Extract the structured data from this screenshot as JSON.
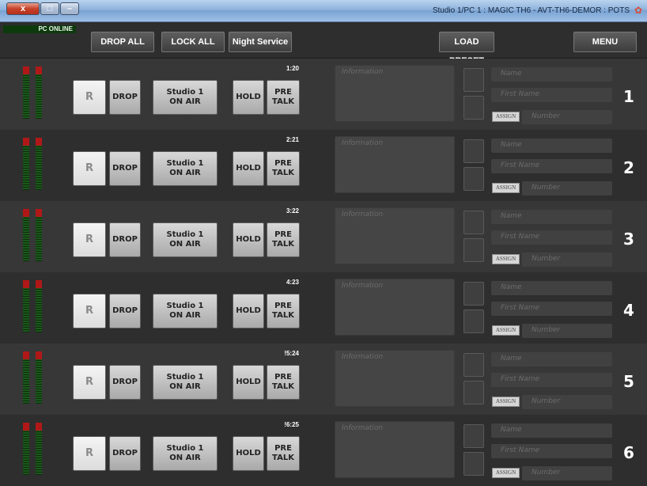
{
  "window": {
    "title": "Studio 1/PC 1 : MAGIC TH6 - AVT-TH6-DEMOR : POTS",
    "close_label": "x",
    "maximize_label": "□",
    "minimize_label": "–"
  },
  "status": {
    "pc_online": "PC ONLINE"
  },
  "toolbar": {
    "drop_all": "DROP ALL",
    "lock_all": "LOCK ALL",
    "night_service": "Night Service",
    "load_preset": "LOAD PRESET",
    "menu": "MENU"
  },
  "lines": [
    {
      "number": "1",
      "timer": "1:20",
      "r_label": "R",
      "drop_label": "DROP",
      "studio_label": "Studio 1",
      "studio_sub": "ON AIR",
      "hold_label": "HOLD",
      "pre_label": "PRE",
      "talk_label": "TALK",
      "info_placeholder": "Information",
      "name_placeholder": "Name",
      "first_name_placeholder": "First Name",
      "assign_label": "ASSIGN",
      "number_placeholder": "Number"
    },
    {
      "number": "2",
      "timer": "2:21",
      "r_label": "R",
      "drop_label": "DROP",
      "studio_label": "Studio 1",
      "studio_sub": "ON AIR",
      "hold_label": "HOLD",
      "pre_label": "PRE",
      "talk_label": "TALK",
      "info_placeholder": "Information",
      "name_placeholder": "Name",
      "first_name_placeholder": "First Name",
      "assign_label": "ASSIGN",
      "number_placeholder": "Number"
    },
    {
      "number": "3",
      "timer": "3:22",
      "r_label": "R",
      "drop_label": "DROP",
      "studio_label": "Studio 1",
      "studio_sub": "ON AIR",
      "hold_label": "HOLD",
      "pre_label": "PRE",
      "talk_label": "TALK",
      "info_placeholder": "Information",
      "name_placeholder": "Name",
      "first_name_placeholder": "First Name",
      "assign_label": "ASSIGN",
      "number_placeholder": "Number"
    },
    {
      "number": "4",
      "timer": "4:23",
      "r_label": "R",
      "drop_label": "DROP",
      "studio_label": "Studio 1",
      "studio_sub": "ON AIR",
      "hold_label": "HOLD",
      "pre_label": "PRE",
      "talk_label": "TALK",
      "info_placeholder": "Information",
      "name_placeholder": "Name",
      "first_name_placeholder": "First Name",
      "assign_label": "ASSIGN",
      "number_placeholder": "Number"
    },
    {
      "number": "5",
      "timer": "!5:24",
      "r_label": "R",
      "drop_label": "DROP",
      "studio_label": "Studio 1",
      "studio_sub": "ON AIR",
      "hold_label": "HOLD",
      "pre_label": "PRE",
      "talk_label": "TALK",
      "info_placeholder": "Information",
      "name_placeholder": "Name",
      "first_name_placeholder": "First Name",
      "assign_label": "ASSIGN",
      "number_placeholder": "Number"
    },
    {
      "number": "6",
      "timer": "!6:25",
      "r_label": "R",
      "drop_label": "DROP",
      "studio_label": "Studio 1",
      "studio_sub": "ON AIR",
      "hold_label": "HOLD",
      "pre_label": "PRE",
      "talk_label": "TALK",
      "info_placeholder": "Information",
      "name_placeholder": "Name",
      "first_name_placeholder": "First Name",
      "assign_label": "ASSIGN",
      "number_placeholder": "Number"
    }
  ],
  "colors": {
    "pc_online_bg": "#0d3a0d",
    "meter_green": "#1a5a1a",
    "meter_peak": "#b01818",
    "line_odd": "#373737",
    "line_even": "#2e2e2e"
  }
}
